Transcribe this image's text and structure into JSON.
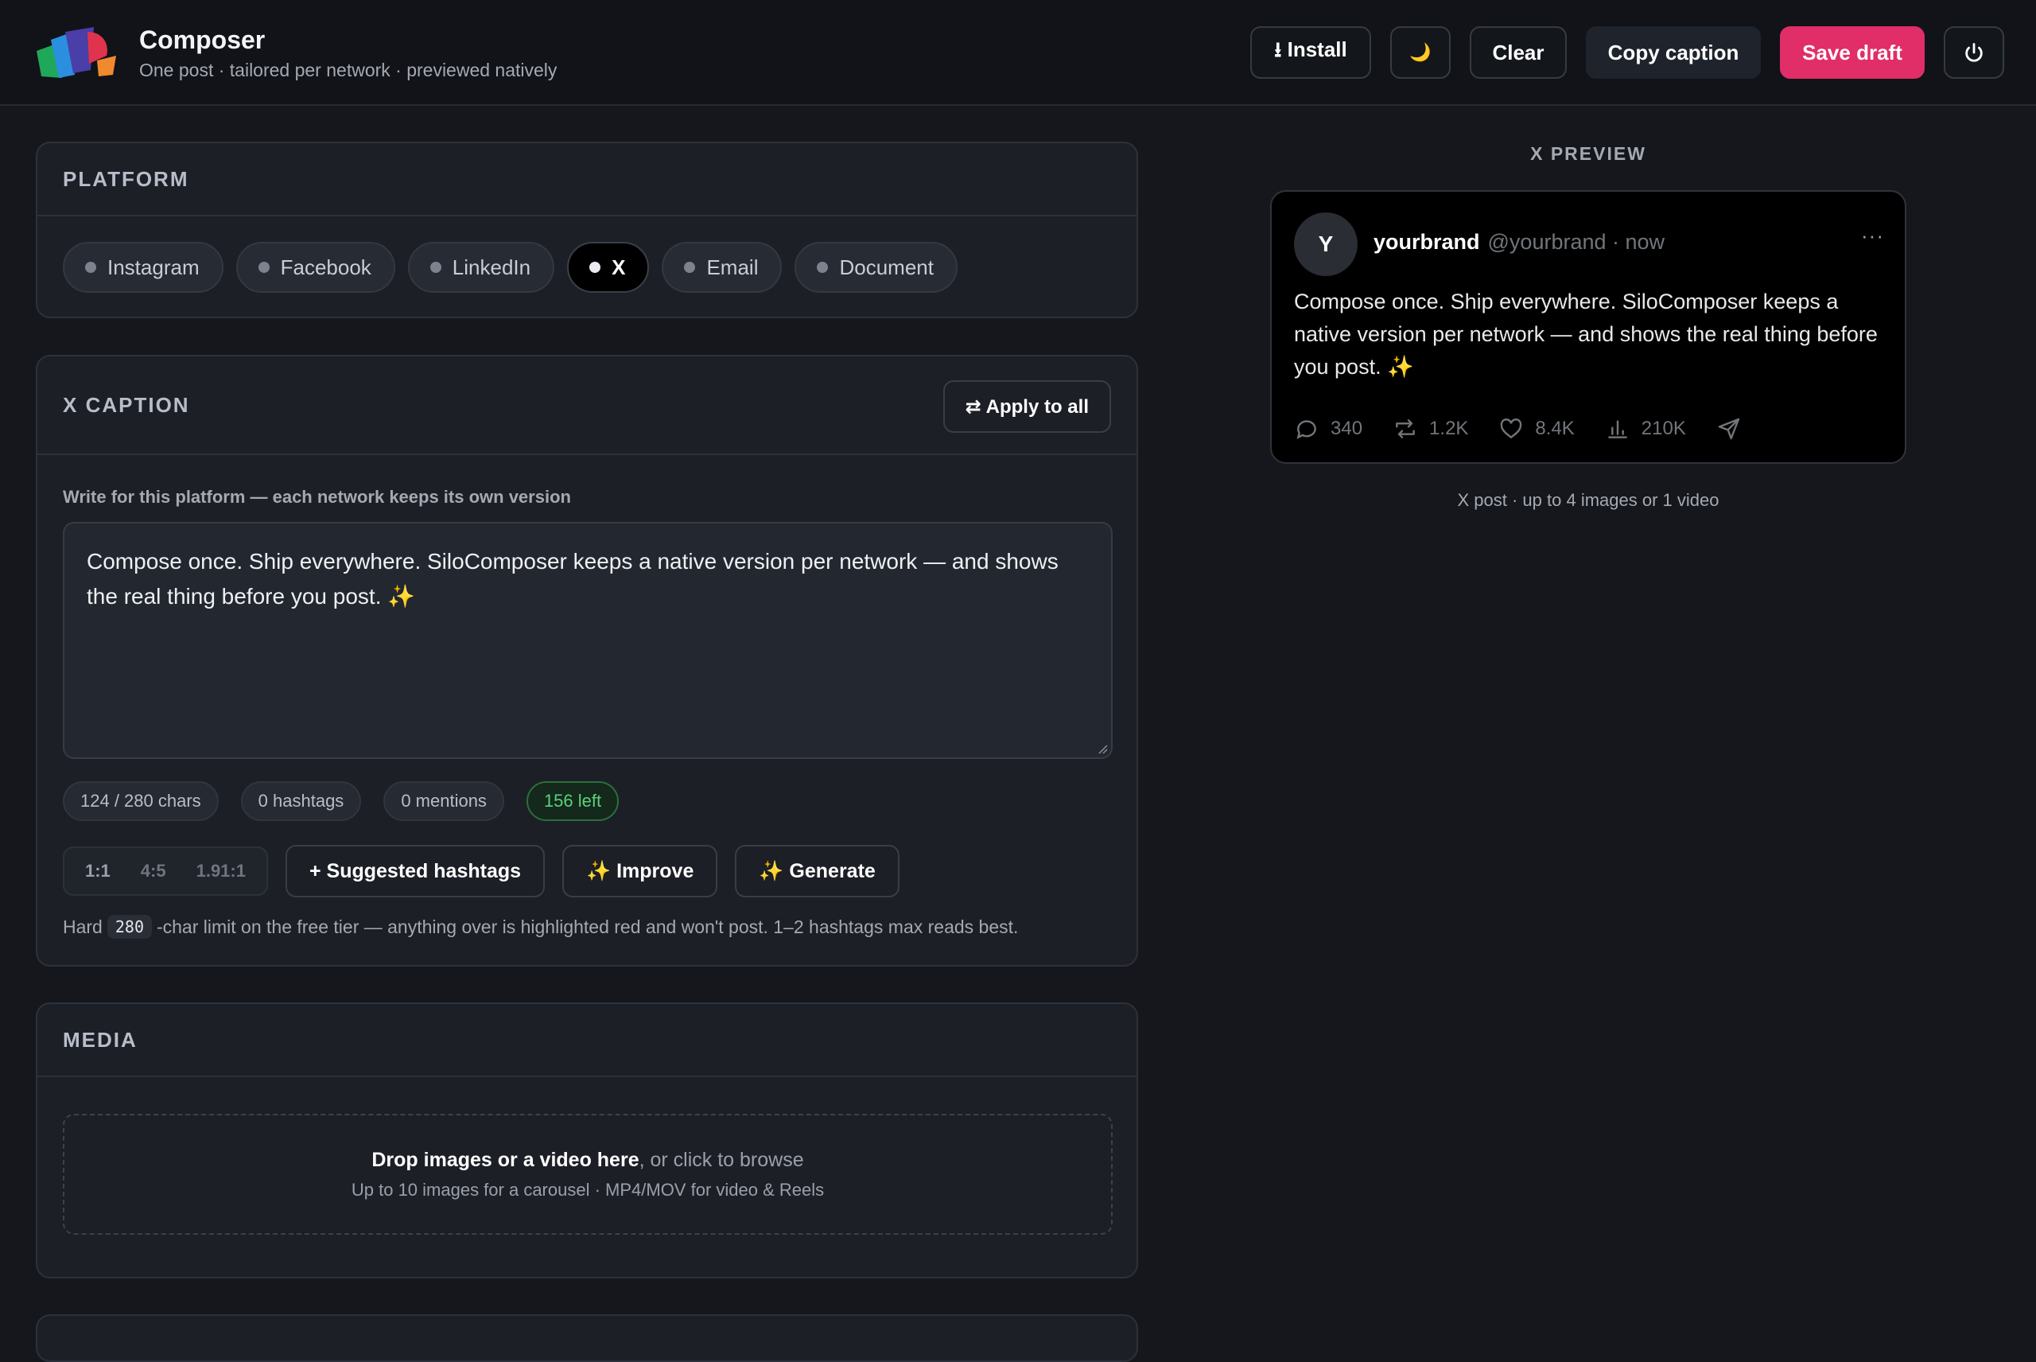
{
  "app": {
    "title": "Composer",
    "subtitle": "One post · tailored per network · previewed natively"
  },
  "toolbar": {
    "install_label": "⭳ Install",
    "theme_icon": "moon-icon",
    "theme_glyph": "🌙",
    "clear_label": "Clear",
    "copy_label": "Copy caption",
    "save_label": "Save draft",
    "power_icon": "power-icon"
  },
  "platform": {
    "title": "PLATFORM",
    "options": [
      {
        "label": "Instagram",
        "active": false
      },
      {
        "label": "Facebook",
        "active": false
      },
      {
        "label": "LinkedIn",
        "active": false
      },
      {
        "label": "X",
        "active": true
      },
      {
        "label": "Email",
        "active": false
      },
      {
        "label": "Document",
        "active": false
      }
    ]
  },
  "caption": {
    "title": "X CAPTION",
    "apply_all": "⇄ Apply to all",
    "field_label": "Write for this platform — each network keeps its own version",
    "text": "Compose once. Ship everywhere. SiloComposer keeps a native version per network — and shows the real thing before you post. ✨",
    "stats": {
      "chars": "124 / 280 chars",
      "hashtags": "0 hashtags",
      "mentions": "0 mentions",
      "left": "156 left"
    },
    "ratios": [
      "1:1",
      "4:5",
      "1.91:1"
    ],
    "suggested": "+ Suggested hashtags",
    "improve": "✨ Improve",
    "generate": "✨ Generate",
    "hint_before": "Hard",
    "hint_code": "280",
    "hint_after": "-char limit on the free tier — anything over is highlighted red and won't post. 1–2 hashtags max reads best."
  },
  "media": {
    "title": "MEDIA",
    "drop_bold": "Drop images or a video here",
    "drop_rest": ", or click to browse",
    "drop_sub": "Up to 10 images for a carousel · MP4/MOV for video & Reels"
  },
  "preview": {
    "title": "X PREVIEW",
    "avatar_initial": "Y",
    "name": "yourbrand",
    "handle": "@yourbrand · now",
    "more": "···",
    "body": "Compose once. Ship everywhere. SiloComposer keeps a native version per network — and shows the real thing before you post. ✨",
    "replies": "340",
    "reposts": "1.2K",
    "likes": "8.4K",
    "views": "210K",
    "note": "X post · up to 4 images or 1 video"
  },
  "colors": {
    "accent": "#e12d68",
    "success": "#5bd17d",
    "background": "#15171c"
  }
}
